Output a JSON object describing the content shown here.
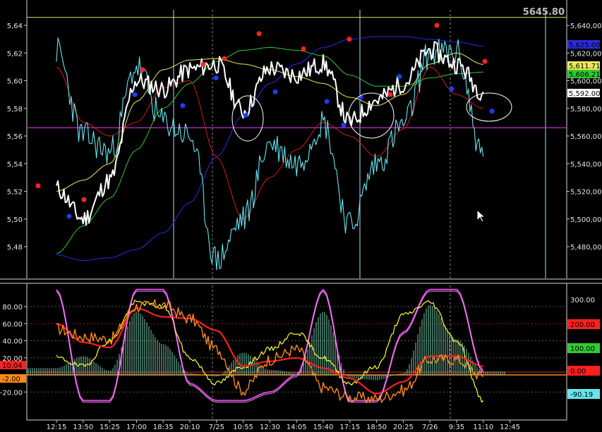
{
  "colors": {
    "background": "#000000",
    "price": "#ffffff",
    "cyan_line": "#66e5ef",
    "red_ma": "#d21c1c",
    "yellow_band": "#ece85a",
    "green_band": "#31c931",
    "blue_ma": "#2c2ce3",
    "magenta_hline": "#c62dc6",
    "top_hline": "#bfe86a",
    "cursor": "#aadff6",
    "peak_marker": "#ff2222",
    "trough_marker": "#1e3cff",
    "osc_histogram": "#8ff0c9",
    "osc_red": "#ff2020",
    "osc_orange": "#ff8a1a",
    "osc_yellow": "#ffff33",
    "osc_magenta": "#e244e2",
    "osc_pink": "#ffb0ff"
  },
  "icons": {
    "mouse_pointer": "arrow-cursor-icon"
  },
  "price_panel": {
    "top_readout": "5645.80",
    "left_ticks": [
      "5,64",
      "5,62",
      "5,60",
      "5,58",
      "5,56",
      "5,54",
      "5,52",
      "5,50",
      "5,48"
    ],
    "right_ticks": [
      "5,640,00",
      "5,620,00",
      "5,600,00",
      "5,580,00",
      "5,560,00",
      "5,540,00",
      "5,520,00",
      "5,500,00",
      "5,480,00"
    ],
    "right_tags": [
      {
        "text": "5,625.00",
        "color": "#2c2ce3",
        "fg": "#000000"
      },
      {
        "text": "5,611.71",
        "color": "#ece85a",
        "fg": "#000000"
      },
      {
        "text": "5,606.21",
        "color": "#31c931",
        "fg": "#000000"
      },
      {
        "text": "5,592.00",
        "color": "#ffffff",
        "fg": "#000000"
      }
    ]
  },
  "osc_panel": {
    "left_ticks": [
      "80.00",
      "60.00",
      "40.00",
      "20.00",
      "-20.00"
    ],
    "right_ticks": [
      "300.00",
      "100.00",
      "-90.19"
    ],
    "left_tags": [
      {
        "text": "10.04",
        "color": "#ff2020",
        "fg": "#000000"
      },
      {
        "text": "-2.00",
        "color": "#ff8a1a",
        "fg": "#000000"
      }
    ],
    "right_tags": [
      {
        "text": "200.00",
        "color": "#ff2020",
        "fg": "#000000"
      },
      {
        "text": "100.00",
        "color": "#31c931",
        "fg": "#000000"
      },
      {
        "text": "0.00",
        "color": "#ff2020",
        "fg": "#000000"
      },
      {
        "text": "-90.19",
        "color": "#66e5ef",
        "fg": "#000000"
      }
    ]
  },
  "x_axis": {
    "labels": [
      "12:15",
      "13:50",
      "15:25",
      "17:00",
      "18:35",
      "20:10",
      "7/25",
      "10:55",
      "12:30",
      "14:05",
      "15:40",
      "17:15",
      "18:50",
      "20:25",
      "7/26",
      "9:35",
      "11:10",
      "12:45"
    ]
  },
  "chart_data": [
    {
      "type": "line",
      "title": "",
      "x": [
        "12:15",
        "13:50",
        "15:25",
        "17:00",
        "18:35",
        "20:10",
        "7/25",
        "10:55",
        "12:30",
        "14:05",
        "15:40",
        "17:15",
        "18:50",
        "20:25",
        "7/26",
        "9:35",
        "11:10",
        "12:45"
      ],
      "ylim": [
        5465,
        5650
      ],
      "grid": false,
      "horizontal_levels": [
        5645.8,
        5566
      ],
      "series": [
        {
          "values": [
            5522,
            5500,
            5528,
            5600,
            5594,
            5608,
            5612,
            5578,
            5609,
            5604,
            5612,
            5570,
            5586,
            5598,
            5622,
            5612,
            5592,
            null
          ]
        },
        {
          "values": [
            5622,
            5560,
            5548,
            5610,
            5570,
            5560,
            5470,
            5500,
            5555,
            5540,
            5570,
            5495,
            5540,
            5568,
            5620,
            5620,
            5545,
            null
          ]
        },
        {
          "values": [
            5610,
            5570,
            5560,
            5570,
            5595,
            5600,
            5545,
            5500,
            5530,
            5550,
            5570,
            5560,
            5545,
            5565,
            5610,
            5590,
            5580,
            null
          ]
        },
        {
          "values": [
            5520,
            5528,
            5540,
            5585,
            5608,
            5615,
            5616,
            5612,
            5608,
            5603,
            5598,
            5588,
            5582,
            5590,
            5612,
            5620,
            5611.71,
            null
          ]
        },
        {
          "values": [
            5475,
            5495,
            5515,
            5550,
            5580,
            5598,
            5614,
            5622,
            5624,
            5622,
            5618,
            5604,
            5596,
            5596,
            5602,
            5605,
            5606.21,
            null
          ]
        },
        {
          "values": [
            5474,
            5470,
            5472,
            5478,
            5490,
            5512,
            5545,
            5575,
            5598,
            5612,
            5624,
            5630,
            5632,
            5632,
            5630,
            5628,
            5625,
            null
          ]
        }
      ],
      "markers": {
        "peaks": [
          5524,
          5514,
          5608,
          5612,
          5616,
          5634,
          5623,
          5630,
          5590,
          5640,
          5614
        ],
        "troughs": [
          5502,
          5590,
          5582,
          5602,
          5575,
          5592,
          5585,
          5568,
          5588,
          5603,
          5594,
          5578
        ]
      }
    },
    {
      "type": "line",
      "title": "",
      "x": [
        "12:15",
        "13:50",
        "15:25",
        "17:00",
        "18:35",
        "20:10",
        "7/25",
        "10:55",
        "12:30",
        "14:05",
        "15:40",
        "17:15",
        "18:50",
        "20:25",
        "7/26",
        "9:35",
        "11:10",
        "12:45"
      ],
      "ylim": [
        -30,
        100
      ],
      "grid": true,
      "series": [
        {
          "values": [
            8,
            22,
            5,
            74,
            36,
            2,
            -2,
            26,
            6,
            3,
            74,
            -4,
            -6,
            2,
            82,
            42,
            4,
            null
          ]
        },
        {
          "values": [
            60,
            38,
            32,
            78,
            68,
            66,
            52,
            10,
            16,
            20,
            8,
            -4,
            -22,
            -8,
            22,
            22,
            10.04,
            null
          ]
        },
        {
          "values": [
            54,
            45,
            42,
            80,
            82,
            66,
            30,
            -18,
            18,
            30,
            -15,
            -26,
            -28,
            -18,
            18,
            18,
            -2,
            null
          ]
        },
        {
          "values": [
            20,
            10,
            40,
            85,
            80,
            20,
            -10,
            10,
            30,
            50,
            20,
            -10,
            10,
            70,
            85,
            40,
            -30,
            null
          ]
        },
        {
          "values": [
            100,
            -30,
            -30,
            100,
            100,
            -10,
            -30,
            -30,
            -20,
            0,
            100,
            -30,
            -30,
            50,
            100,
            100,
            5,
            null
          ]
        }
      ]
    }
  ]
}
